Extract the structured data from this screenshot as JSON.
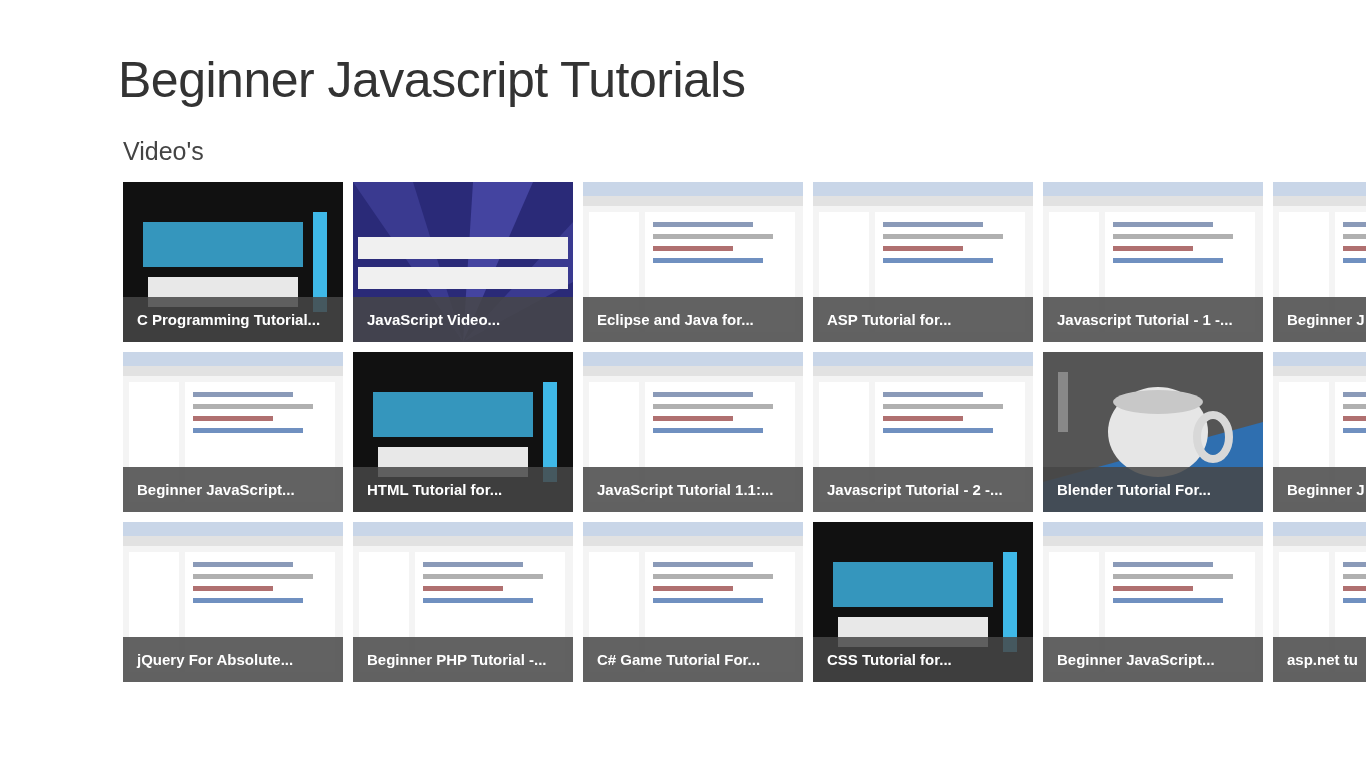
{
  "page": {
    "title": "Beginner Javascript Tutorials"
  },
  "section": {
    "heading": "Video's"
  },
  "videos": [
    {
      "title": "C Programming Tutorial..."
    },
    {
      "title": "JavaScript Video..."
    },
    {
      "title": "Eclipse and Java for..."
    },
    {
      "title": "ASP Tutorial for..."
    },
    {
      "title": "Javascript Tutorial - 1 -..."
    },
    {
      "title": "Beginner J"
    },
    {
      "title": "Beginner JavaScript..."
    },
    {
      "title": "HTML Tutorial for..."
    },
    {
      "title": "JavaScript Tutorial 1.1:..."
    },
    {
      "title": "Javascript Tutorial - 2 -..."
    },
    {
      "title": "Blender Tutorial For..."
    },
    {
      "title": "Beginner J"
    },
    {
      "title": "jQuery For Absolute..."
    },
    {
      "title": "Beginner PHP Tutorial -..."
    },
    {
      "title": "C# Game Tutorial For..."
    },
    {
      "title": "CSS Tutorial for..."
    },
    {
      "title": "Beginner JavaScript..."
    },
    {
      "title": "asp.net tu"
    }
  ]
}
